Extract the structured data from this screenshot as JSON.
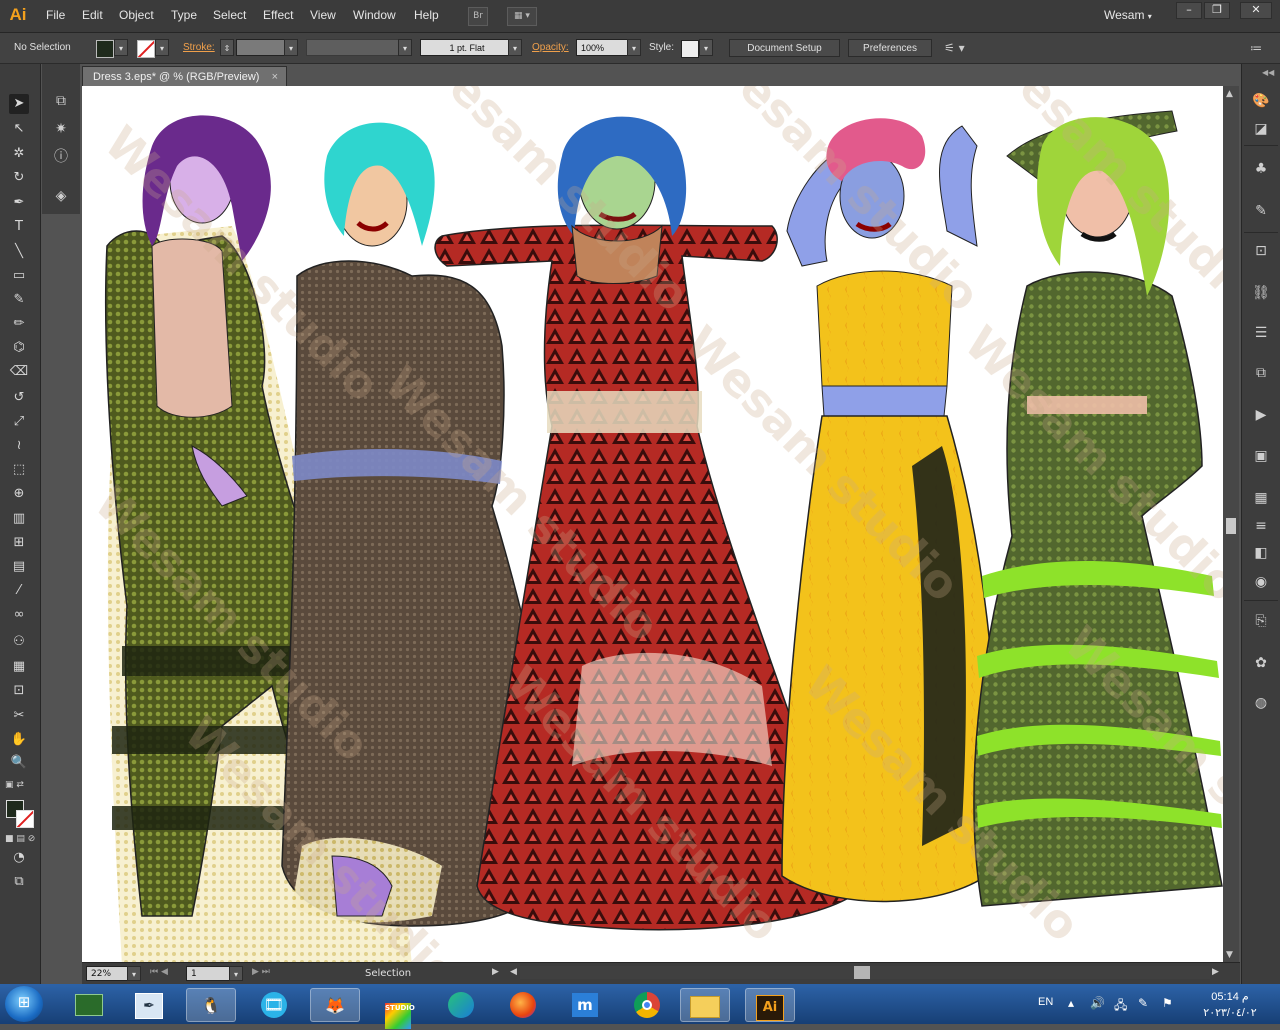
{
  "app": {
    "logo": "Ai",
    "workspace": "Wesam"
  },
  "menu": [
    "File",
    "Edit",
    "Object",
    "Type",
    "Select",
    "Effect",
    "View",
    "Window",
    "Help"
  ],
  "menubar_buttons": {
    "bridge": "Br"
  },
  "window_controls": [
    "–",
    "❐",
    "✕"
  ],
  "control_bar": {
    "selection": "No Selection",
    "stroke_label": "Stroke:",
    "stroke_profile": "1 pt. Flat",
    "opacity_label": "Opacity:",
    "opacity_value": "100%",
    "style_label": "Style:",
    "document_setup": "Document Setup",
    "preferences": "Preferences"
  },
  "document": {
    "tab_title": "Dress 3.eps* @ % (RGB/Preview)",
    "close": "×"
  },
  "status_bar": {
    "zoom": "22%",
    "artboard": "1",
    "tool": "Selection"
  },
  "canvas": {
    "watermark": "Wesam studio"
  },
  "taskbar": {
    "lang": "EN",
    "time": "05:14 م",
    "date": "٢٠٢٣/٠٤/٠٢",
    "apps": [
      "task-manager",
      "pen-tool",
      "photo-app",
      "media-player",
      "gimp",
      "studio",
      "edge",
      "firefox",
      "maxon",
      "chrome",
      "file-explorer",
      "illustrator"
    ],
    "studio_label": "STUDIO",
    "ai_label": "Ai"
  },
  "colors": {
    "accent": "#f4a11d",
    "canvas_bg": "#ffffff",
    "ui_dark": "#3d3d3d"
  }
}
